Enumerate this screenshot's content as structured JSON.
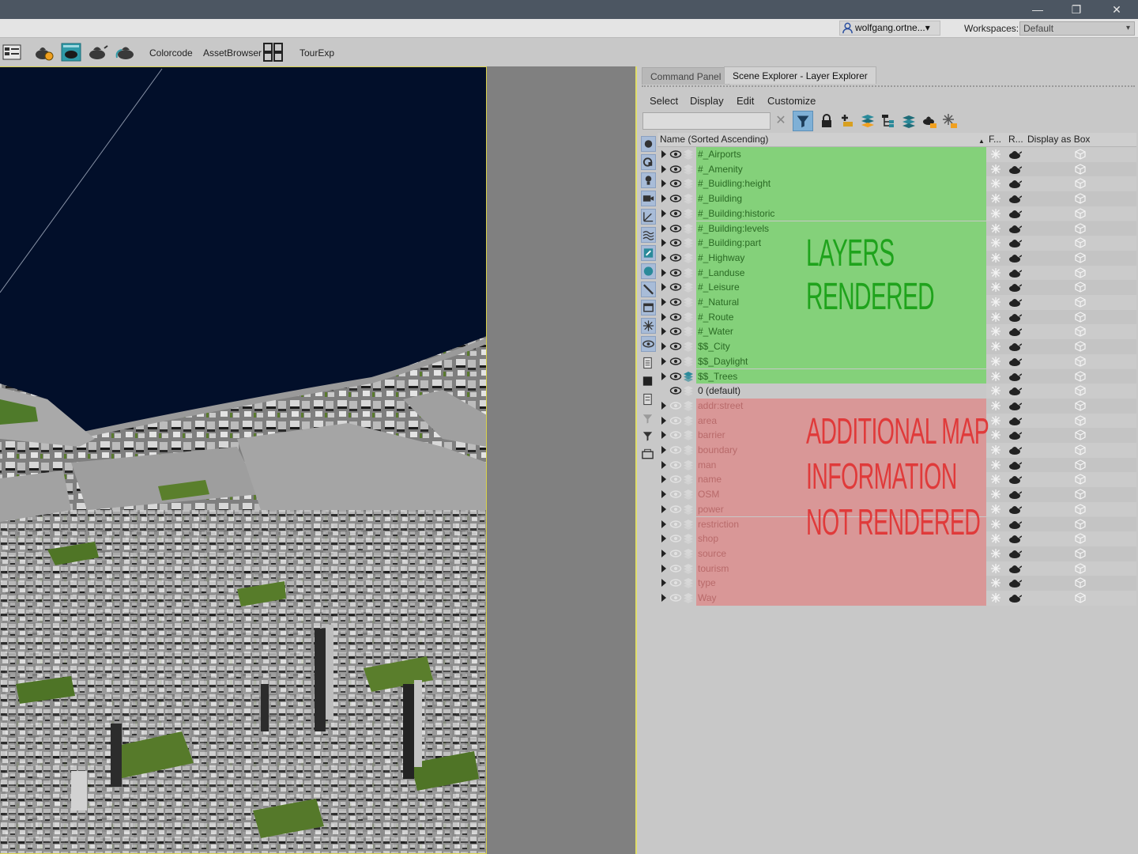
{
  "window": {
    "minimize_glyph": "—",
    "restore_glyph": "❐",
    "close_glyph": "✕"
  },
  "user_bar": {
    "user_name": "wolfgang.ortne...",
    "user_caret": "▾",
    "workspaces_label": "Workspaces:",
    "workspace_value": "Default",
    "workspace_caret": "▾"
  },
  "toolbar": {
    "colorcode": "Colorcode",
    "asset_browser": "AssetBrowser",
    "tour_exp": "TourExp"
  },
  "panel": {
    "tabs": [
      "Command Panel",
      "Scene Explorer - Layer Explorer"
    ],
    "menu": [
      "Select",
      "Display",
      "Edit",
      "Customize"
    ],
    "search_value": "",
    "search_clear": "✕",
    "columns": {
      "name": "Name (Sorted Ascending)",
      "sort_arrow": "▲",
      "frozen": "F...",
      "render": "R...",
      "display_box": "Display as Box"
    }
  },
  "colors": {
    "rendered_highlight": "#84d17a",
    "not_rendered_highlight": "#d99797",
    "rendered_annotation": "#1fa31c",
    "not_rendered_annotation": "#e03a3a",
    "viewport_sky": "#020f2a"
  },
  "layers": [
    {
      "name": "#_Airports",
      "group": "rendered"
    },
    {
      "name": "#_Amenity",
      "group": "rendered"
    },
    {
      "name": "#_Buidling:height",
      "group": "rendered"
    },
    {
      "name": "#_Building",
      "group": "rendered"
    },
    {
      "name": "#_Building:historic",
      "group": "rendered"
    },
    {
      "name": "#_Building:levels",
      "group": "rendered"
    },
    {
      "name": "#_Building:part",
      "group": "rendered"
    },
    {
      "name": "#_Highway",
      "group": "rendered"
    },
    {
      "name": "#_Landuse",
      "group": "rendered"
    },
    {
      "name": "#_Leisure",
      "group": "rendered"
    },
    {
      "name": "#_Natural",
      "group": "rendered"
    },
    {
      "name": "#_Route",
      "group": "rendered"
    },
    {
      "name": "#_Water",
      "group": "rendered"
    },
    {
      "name": "$$_City",
      "group": "rendered"
    },
    {
      "name": "$$_Daylight",
      "group": "rendered"
    },
    {
      "name": "$$_Trees",
      "group": "rendered",
      "active": true
    },
    {
      "name": "0 (default)",
      "group": "default"
    },
    {
      "name": "addr:street",
      "group": "not_rendered"
    },
    {
      "name": "area",
      "group": "not_rendered"
    },
    {
      "name": "barrier",
      "group": "not_rendered"
    },
    {
      "name": "boundary",
      "group": "not_rendered"
    },
    {
      "name": "man",
      "group": "not_rendered"
    },
    {
      "name": "name",
      "group": "not_rendered"
    },
    {
      "name": "OSM",
      "group": "not_rendered"
    },
    {
      "name": "power",
      "group": "not_rendered"
    },
    {
      "name": "restriction",
      "group": "not_rendered"
    },
    {
      "name": "shop",
      "group": "not_rendered"
    },
    {
      "name": "source",
      "group": "not_rendered"
    },
    {
      "name": "tourism",
      "group": "not_rendered"
    },
    {
      "name": "type",
      "group": "not_rendered"
    },
    {
      "name": "Way",
      "group": "not_rendered"
    }
  ],
  "annotations": {
    "rendered": "LAYERS RENDERED",
    "not_rendered_lines": [
      "ADDITIONAL MAP",
      "INFORMATION",
      "NOT RENDERED"
    ]
  }
}
